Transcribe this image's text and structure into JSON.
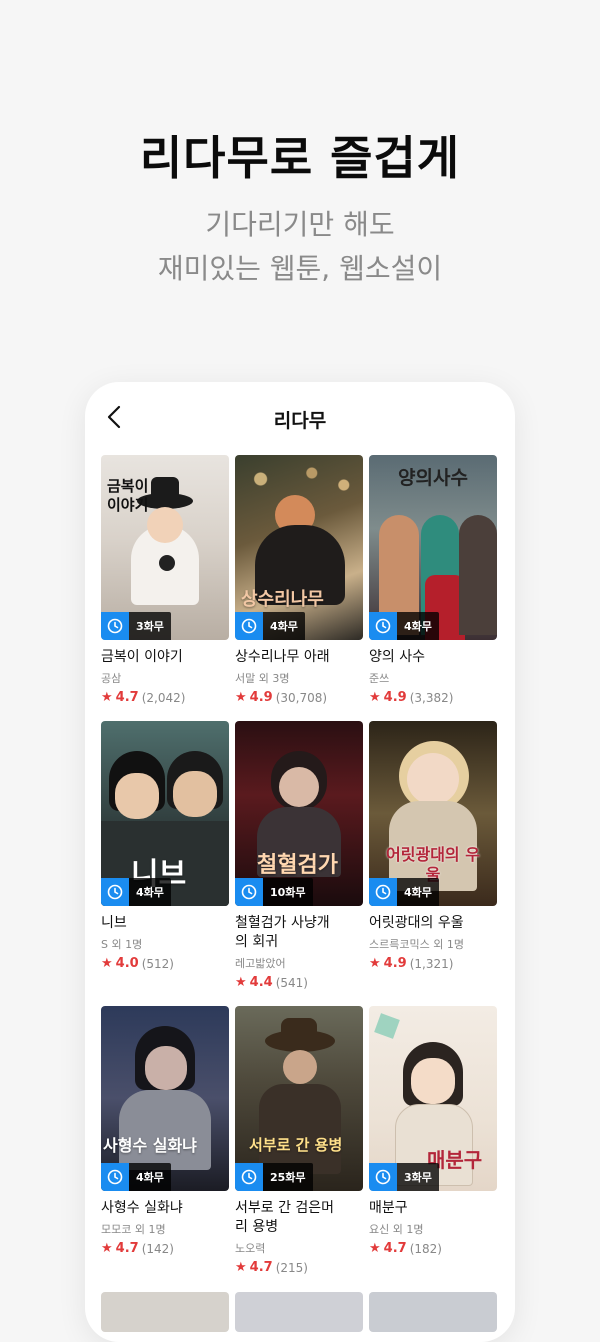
{
  "hero": {
    "title": "리다무로 즐겁게",
    "subtitle_line1": "기다리기만 해도",
    "subtitle_line2": "재미있는 웹툰, 웹소설이"
  },
  "nav": {
    "title": "리다무"
  },
  "colors": {
    "accent_blue": "#1a8cf0",
    "rating_red": "#e23b3b"
  },
  "books": [
    {
      "title": "금복이 이야기",
      "cover_text": "금복이 이야기",
      "author": "공삼",
      "score": "4.7",
      "count": "(2,042)",
      "badge": "3화무"
    },
    {
      "title": "상수리나무 아래",
      "cover_text": "상수리나무",
      "author": "서말 외 3명",
      "score": "4.9",
      "count": "(30,708)",
      "badge": "4화무"
    },
    {
      "title": "양의 사수",
      "cover_text": "양의사수",
      "author": "준쓰",
      "score": "4.9",
      "count": "(3,382)",
      "badge": "4화무"
    },
    {
      "title": "니브",
      "cover_text": "니브",
      "author": "S 외 1명",
      "score": "4.0",
      "count": "(512)",
      "badge": "4화무"
    },
    {
      "title": "철혈검가 사냥개의 회귀",
      "cover_text": "철혈검가",
      "author": "레고밟았어",
      "score": "4.4",
      "count": "(541)",
      "badge": "10화무"
    },
    {
      "title": "어릿광대의 우울",
      "cover_text": "어릿광대의 우울",
      "author": "스르륵코믹스 외 1명",
      "score": "4.9",
      "count": "(1,321)",
      "badge": "4화무"
    },
    {
      "title": "사형수 실화냐",
      "cover_text": "사형수 실화냐",
      "author": "모모코 외 1명",
      "score": "4.7",
      "count": "(142)",
      "badge": "4화무"
    },
    {
      "title": "서부로 간 검은머리 용병",
      "cover_text": "서부로 간 용병",
      "author": "노오력",
      "score": "4.7",
      "count": "(215)",
      "badge": "25화무"
    },
    {
      "title": "매분구",
      "cover_text": "매분구",
      "author": "요신 외 1명",
      "score": "4.7",
      "count": "(182)",
      "badge": "3화무"
    }
  ]
}
